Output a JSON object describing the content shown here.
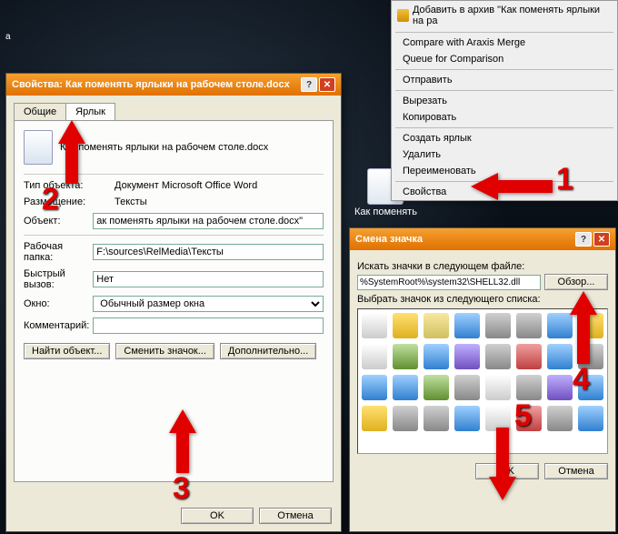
{
  "desktop": {
    "label_a": "а",
    "icon_caption": "Как поменять"
  },
  "contextmenu": {
    "archive": "Добавить в архив \"Как поменять ярлыки на ра",
    "items": [
      "Compare with Araxis Merge",
      "Queue for Comparison",
      "Отправить",
      "Вырезать",
      "Копировать",
      "Создать ярлык",
      "Удалить",
      "Переименовать",
      "Свойства"
    ]
  },
  "props": {
    "title": "Свойства: Как поменять ярлыки на рабочем столе.docx",
    "tabs": {
      "general": "Общие",
      "shortcut": "Ярлык"
    },
    "filename": "Как поменять ярлыки на рабочем столе.docx",
    "rows": {
      "type_lbl": "Тип объекта:",
      "type_val": "Документ Microsoft Office Word",
      "location_lbl": "Размещение:",
      "location_val": "Тексты",
      "target_lbl": "Объект:",
      "target_val": "ак поменять ярлыки на рабочем столе.docx\"",
      "workdir_lbl": "Рабочая папка:",
      "workdir_val": "F:\\sources\\RelMedia\\Тексты",
      "hotkey_lbl": "Быстрый вызов:",
      "hotkey_val": "Нет",
      "window_lbl": "Окно:",
      "window_val": "Обычный размер окна",
      "comment_lbl": "Комментарий:",
      "comment_val": ""
    },
    "buttons": {
      "find": "Найти объект...",
      "change_icon": "Сменить значок...",
      "advanced": "Дополнительно..."
    },
    "footer": {
      "ok": "OK",
      "cancel": "Отмена"
    }
  },
  "icondlg": {
    "title": "Смена значка",
    "search_lbl": "Искать значки в следующем файле:",
    "path": "%SystemRoot%\\system32\\SHELL32.dll",
    "browse": "Обзор...",
    "list_lbl": "Выбрать значок из следующего списка:",
    "footer": {
      "ok": "OK",
      "cancel": "Отмена"
    }
  },
  "callouts": {
    "n1": "1",
    "n2": "2",
    "n3": "3",
    "n4": "4",
    "n5": "5"
  }
}
